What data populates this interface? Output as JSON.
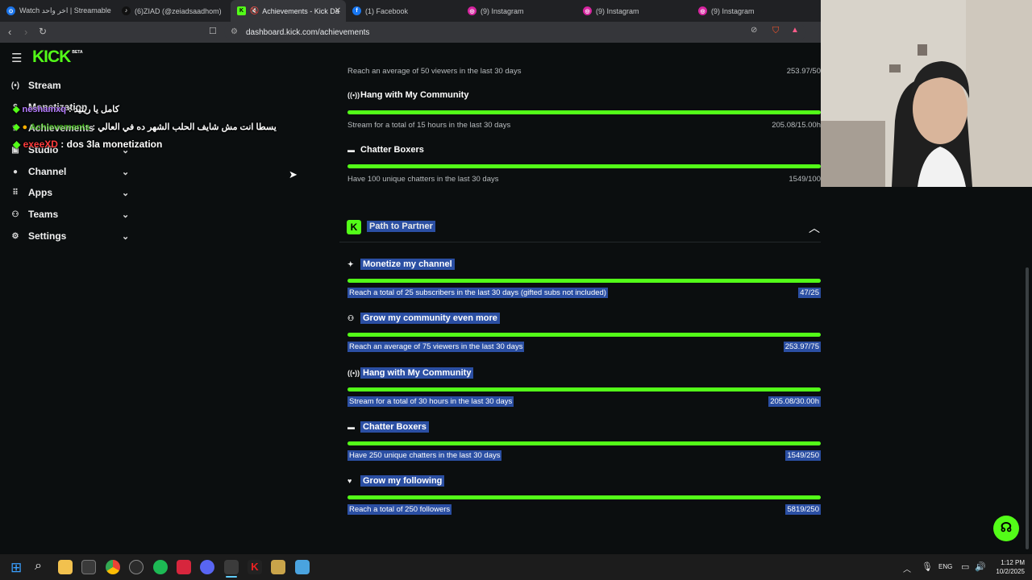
{
  "browser": {
    "tabs": [
      {
        "label": "Watch اخر واحد | Streamable",
        "color": "#1a73e8"
      },
      {
        "label": "(6)ZIAD (@zeiadsaadhom)",
        "color": "#111111"
      },
      {
        "label": "Achievements - Kick Da",
        "color": "#53fc18"
      },
      {
        "label": "(1) Facebook",
        "color": "#1877f2"
      },
      {
        "label": "(9) Instagram",
        "color": "#d6249f"
      },
      {
        "label": "(9) Instagram",
        "color": "#d6249f"
      },
      {
        "label": "(9) Instagram",
        "color": "#d6249f"
      }
    ],
    "url": "dashboard.kick.com/achievements"
  },
  "sidebar": {
    "logo": "KICK",
    "logo_badge": "BETA",
    "items": [
      {
        "label": "Stream",
        "icon": "broadcast-icon"
      },
      {
        "label": "Monetization",
        "icon": "dollar-icon"
      },
      {
        "label": "Achievements",
        "icon": "trophy-icon"
      },
      {
        "label": "Studio",
        "icon": "video-icon"
      },
      {
        "label": "Channel",
        "icon": "user-icon"
      },
      {
        "label": "Apps",
        "icon": "grid-icon"
      },
      {
        "label": "Teams",
        "icon": "team-icon"
      },
      {
        "label": "Settings",
        "icon": "gear-icon"
      }
    ]
  },
  "chat": [
    {
      "user": "neshamxq",
      "message": ": كامل يا ريتيد",
      "color": "#b57cff"
    },
    {
      "user": "Achievements",
      "message": ": يسطا انت مش شايف الحلب الشهر ده في العالي",
      "color": "#53fc18"
    },
    {
      "user": "exeeXD",
      "message": ": dos 3la monetization",
      "color": "#ff3b3b"
    }
  ],
  "top_section": [
    {
      "title": "",
      "desc": "Reach an average of 50 viewers in the last 30 days",
      "value": "253.97/50"
    },
    {
      "title": "Hang with My Community",
      "icon": "broadcast-icon",
      "desc": "Stream for a total of 15 hours in the last 30 days",
      "value": "205.08/15.00h"
    },
    {
      "title": "Chatter Boxers",
      "icon": "chat-icon",
      "desc": "Have 100 unique chatters in the last 30 days",
      "value": "1549/100"
    }
  ],
  "partner": {
    "title": "Path to Partner",
    "achievements": [
      {
        "title": "Monetize my channel",
        "icon": "sparkle-icon",
        "desc": "Reach a total of 25 subscribers in the last 30 days (gifted subs not included)",
        "value": "47/25"
      },
      {
        "title": "Grow my community even more",
        "icon": "users-plus-icon",
        "desc": "Reach an average of 75 viewers in the last 30 days",
        "value": "253.97/75"
      },
      {
        "title": "Hang with My Community",
        "icon": "broadcast-icon",
        "desc": "Stream for a total of 30 hours in the last 30 days",
        "value": "205.08/30.00h"
      },
      {
        "title": "Chatter Boxers",
        "icon": "chat-icon",
        "desc": "Have 250 unique chatters in the last 30 days",
        "value": "1549/250"
      },
      {
        "title": "Grow my following",
        "icon": "heart-icon",
        "desc": "Reach a total of 250 followers",
        "value": "5819/250"
      }
    ]
  },
  "taskbar": {
    "lang": "ENG",
    "time": "1:12 PM",
    "date": "10/2/2025"
  },
  "accent": "#53fc18"
}
